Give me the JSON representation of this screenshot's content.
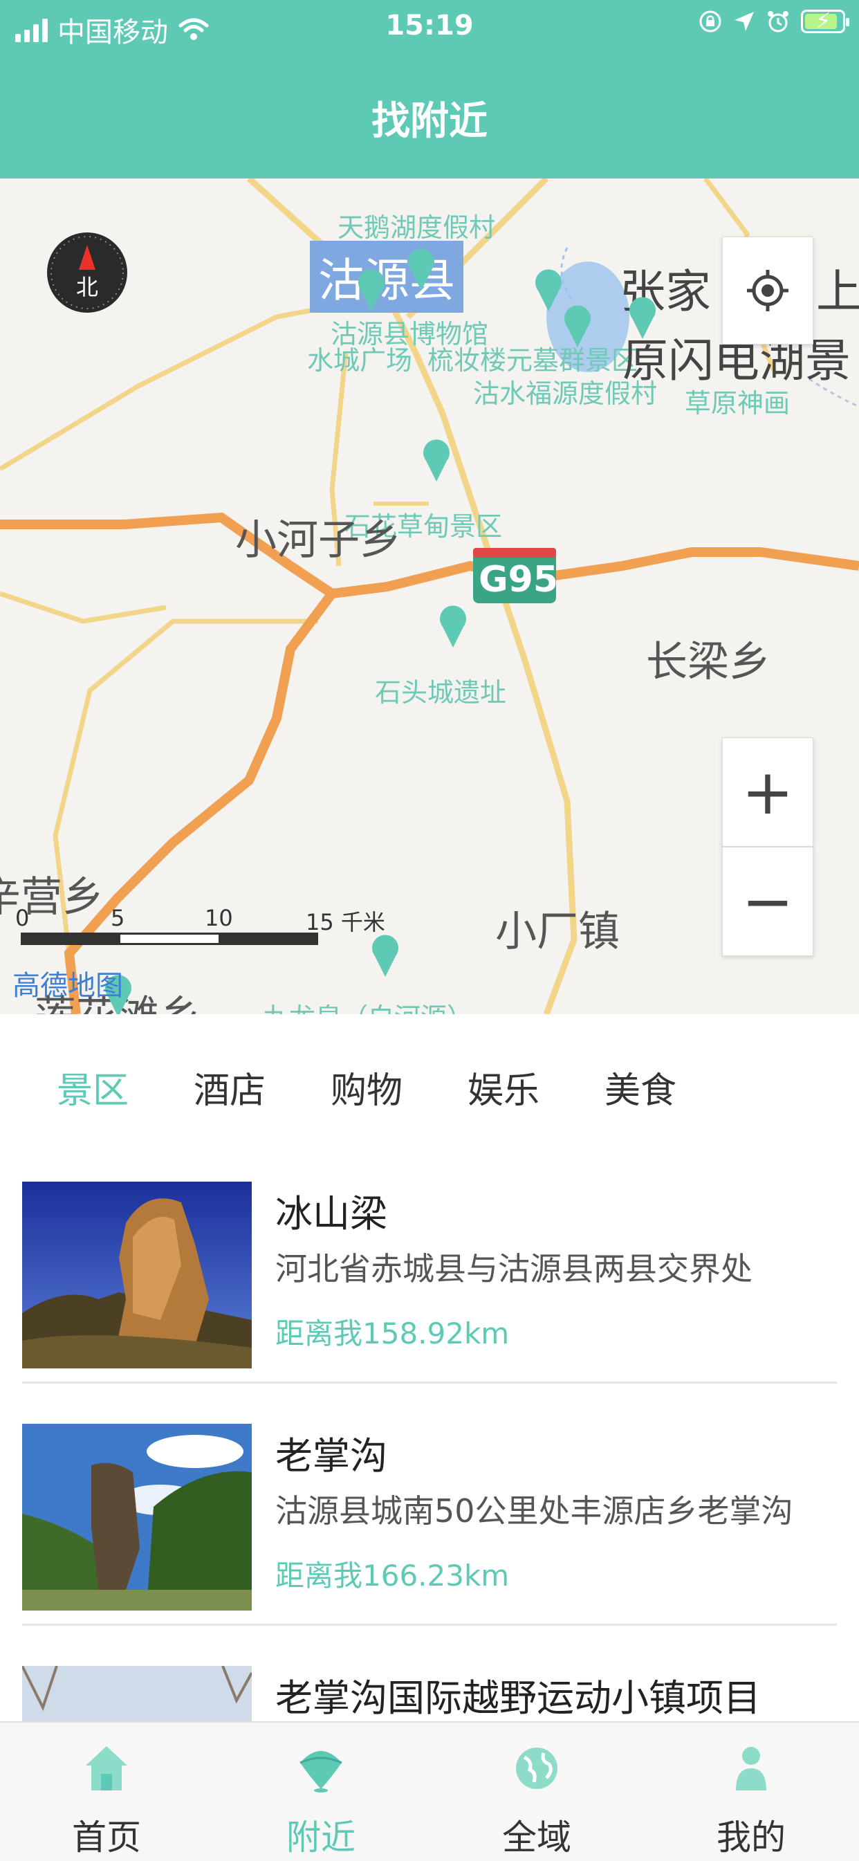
{
  "status_bar": {
    "carrier": "中国移动",
    "time": "15:19"
  },
  "header": {
    "title": "找附近"
  },
  "map": {
    "places": {
      "tianehu": "天鹅湖度假村",
      "guyuan_county": "沽源县",
      "zhangjia": "张家",
      "shang": "上",
      "museum": "沽源县博物馆",
      "shuicheng": "水城广场",
      "liushulou": "梳妆楼元墓群景区",
      "yuandian_lake": "原闪电湖景",
      "gushui": "沽水福源度假村",
      "caoyuan": "草原神画",
      "shihua": "石花草甸景区",
      "xiaohezi": "小河子乡",
      "g95": "G95",
      "shitoucheng": "石头城遗址",
      "changliang": "长梁乡",
      "xinying": "辛营乡",
      "xiaochang": "小厂镇",
      "lianhuatan": "莲花滩乡",
      "jiulong": "九龙泉（白河源）"
    },
    "scale": {
      "t0": "0",
      "t5": "5",
      "t10": "10",
      "t15": "15 千米"
    },
    "logo": "高德地图",
    "compass_label": "北",
    "zoom_in_label": "+",
    "zoom_out_label": "−"
  },
  "tabs": [
    {
      "label": "景区",
      "active": true
    },
    {
      "label": "酒店",
      "active": false
    },
    {
      "label": "购物",
      "active": false
    },
    {
      "label": "娱乐",
      "active": false
    },
    {
      "label": "美食",
      "active": false
    }
  ],
  "list": [
    {
      "name": "冰山梁",
      "address": "河北省赤城县与沽源县两县交界处",
      "distance": "距离我158.92km"
    },
    {
      "name": "老掌沟",
      "address": "沽源县城南50公里处丰源店乡老掌沟",
      "distance": "距离我166.23km"
    },
    {
      "name": "老掌沟国际越野运动小镇项目",
      "address": "",
      "distance": ""
    }
  ],
  "bottom_nav": [
    {
      "label": "首页",
      "icon": "home-icon",
      "active": false
    },
    {
      "label": "附近",
      "icon": "nearby-icon",
      "active": true
    },
    {
      "label": "全域",
      "icon": "globe-icon",
      "active": false
    },
    {
      "label": "我的",
      "icon": "profile-icon",
      "active": false
    }
  ],
  "colors": {
    "accent": "#5ecab5",
    "road_major": "#f0a050",
    "road_minor": "#f3d58a",
    "map_bg": "#f5f3ef"
  }
}
